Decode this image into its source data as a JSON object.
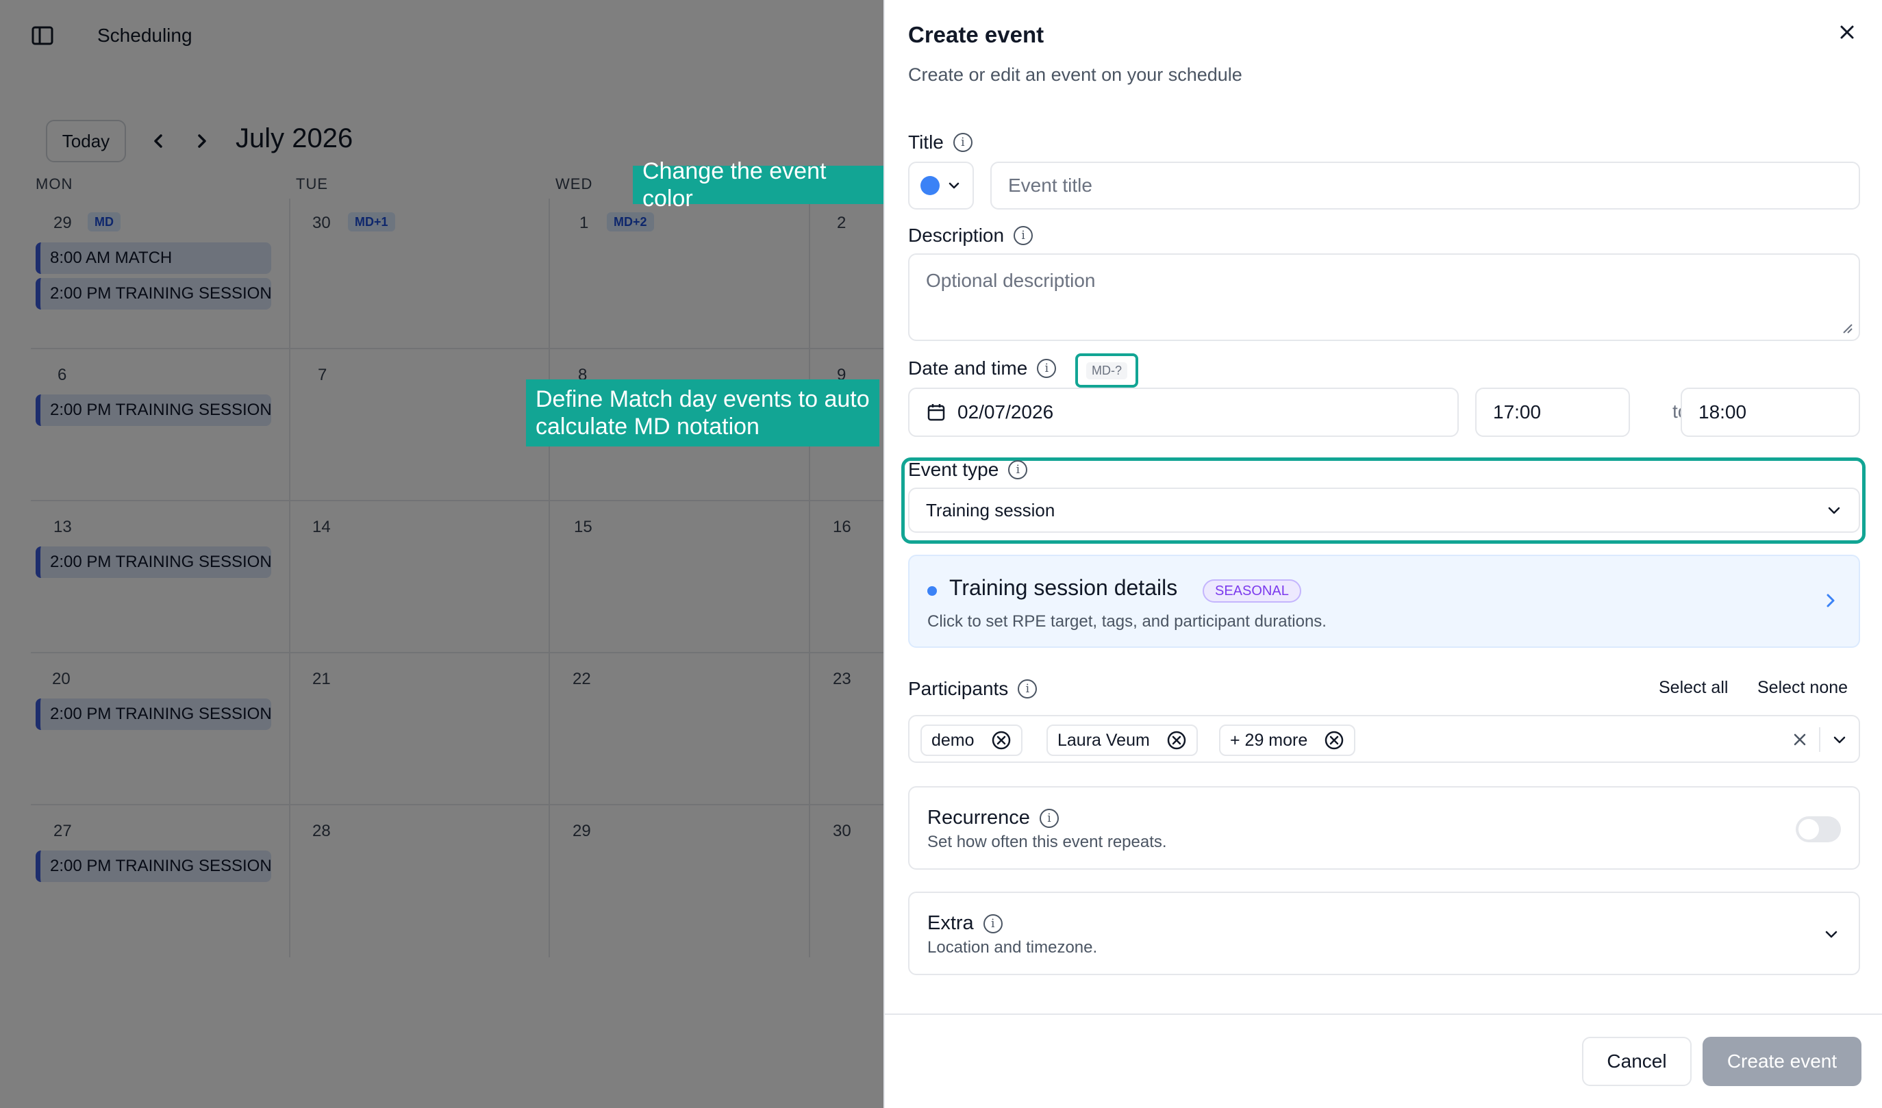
{
  "app": {
    "title": "Scheduling"
  },
  "calendar": {
    "today_label": "Today",
    "month_title": "July 2026",
    "day_headers": [
      "MON",
      "TUE",
      "WED"
    ],
    "weeks": [
      {
        "dates": [
          "29",
          "30",
          "1",
          "2"
        ],
        "badges": [
          "MD",
          "MD+1",
          "MD+2"
        ],
        "events": [
          "8:00 AM MATCH",
          "2:00 PM TRAINING SESSION"
        ]
      },
      {
        "dates": [
          "6",
          "7",
          "8",
          "9"
        ],
        "events": [
          "2:00 PM TRAINING SESSION"
        ]
      },
      {
        "dates": [
          "13",
          "14",
          "15",
          "16"
        ],
        "events": [
          "2:00 PM TRAINING SESSION"
        ]
      },
      {
        "dates": [
          "20",
          "21",
          "22",
          "23"
        ],
        "events": [
          "2:00 PM TRAINING SESSION"
        ]
      },
      {
        "dates": [
          "27",
          "28",
          "29",
          "30"
        ],
        "events": [
          "2:00 PM TRAINING SESSION"
        ]
      }
    ]
  },
  "callouts": {
    "color": "Change the event color",
    "md_line1": "Define Match day events to auto",
    "md_line2": "calculate MD notation"
  },
  "panel": {
    "title": "Create event",
    "subtitle": "Create or edit an event on your schedule",
    "title_label": "Title",
    "title_placeholder": "Event title",
    "event_color": "#3b82f6",
    "description_label": "Description",
    "description_placeholder": "Optional description",
    "datetime_label": "Date and time",
    "md_badge": "MD-?",
    "date_value": "02/07/2026",
    "start_time": "17:00",
    "to_label": "to",
    "end_time": "18:00",
    "event_type_label": "Event type",
    "event_type_value": "Training session",
    "details": {
      "title": "Training session details",
      "badge": "SEASONAL",
      "subtitle": "Click to set RPE target, tags, and participant durations."
    },
    "participants": {
      "label": "Participants",
      "select_all": "Select all",
      "select_none": "Select none",
      "chips": [
        "demo",
        "Laura Veum",
        "+ 29 more"
      ]
    },
    "recurrence": {
      "title": "Recurrence",
      "subtitle": "Set how often this event repeats.",
      "enabled": false
    },
    "extra": {
      "title": "Extra",
      "subtitle": "Location and timezone."
    },
    "cancel_label": "Cancel",
    "create_label": "Create event"
  },
  "colors": {
    "accent": "#12a594",
    "event_blue": "#3b82f6"
  }
}
